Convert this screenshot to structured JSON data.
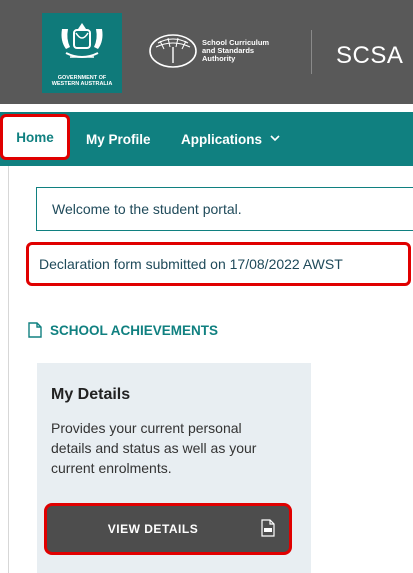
{
  "header": {
    "gov_label_line1": "GOVERNMENT OF",
    "gov_label_line2": "WESTERN AUSTRALIA",
    "org_line1": "School Curriculum",
    "org_line2": "and Standards",
    "org_line3": "Authority",
    "title": "SCSA"
  },
  "nav": {
    "home": "Home",
    "profile": "My Profile",
    "applications": "Applications"
  },
  "main": {
    "welcome": "Welcome to the student portal.",
    "declaration": "Declaration form submitted on 17/08/2022 AWST",
    "section_title": "SCHOOL ACHIEVEMENTS",
    "card": {
      "title": "My Details",
      "description": "Provides your current personal details and status as well as your current enrolments.",
      "button_label": "VIEW DETAILS"
    }
  },
  "colors": {
    "header_bg": "#595959",
    "nav_bg": "#108080",
    "highlight": "#e00000",
    "card_bg": "#e8eef2"
  }
}
